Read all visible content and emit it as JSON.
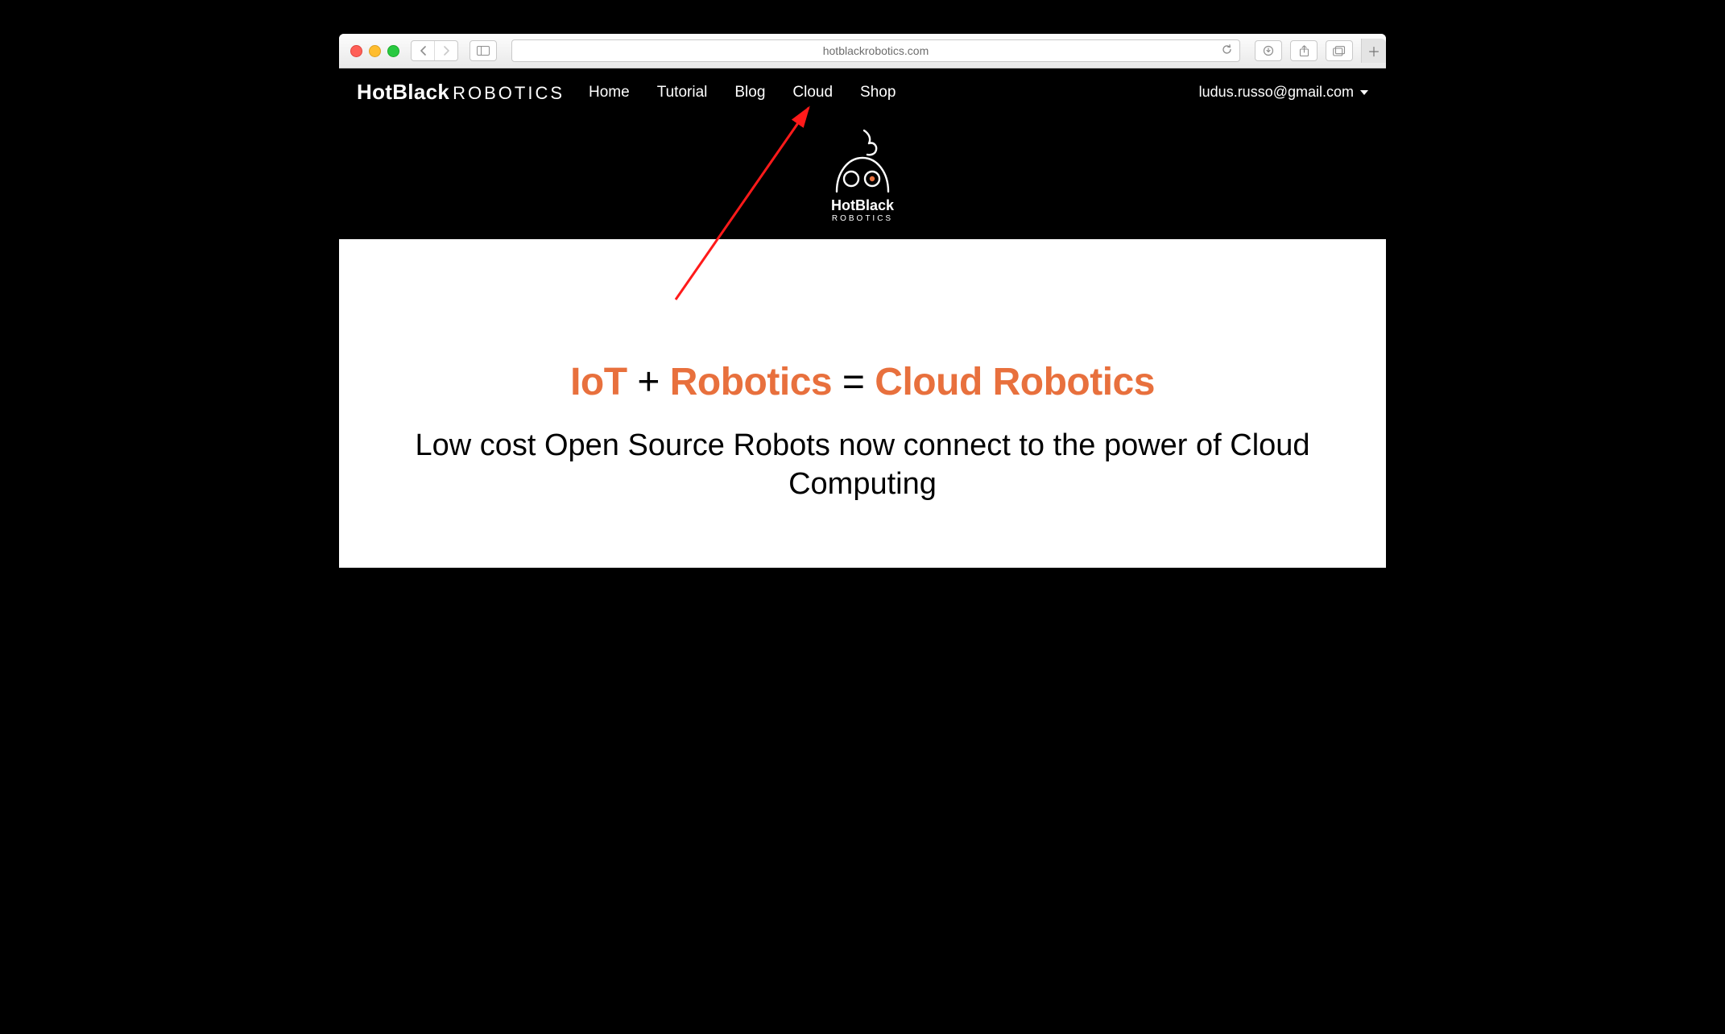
{
  "browser": {
    "url_display": "hotblackrobotics.com"
  },
  "header": {
    "brand_bold": "HotBlack",
    "brand_thin": "ROBOTICS",
    "nav": [
      {
        "label": "Home"
      },
      {
        "label": "Tutorial"
      },
      {
        "label": "Blog"
      },
      {
        "label": "Cloud"
      },
      {
        "label": "Shop"
      }
    ],
    "user_email": "ludus.russo@gmail.com"
  },
  "logo": {
    "line1_bold": "HotBlack",
    "line2": "ROBOTICS"
  },
  "hero": {
    "accent1": "IoT",
    "plain1": " + ",
    "accent2": "Robotics",
    "plain2": " = ",
    "accent3": "Cloud Robotics",
    "subhead": "Low cost Open Source Robots now connect to the power of Cloud Computing"
  },
  "annotation": {
    "points_to_nav_index": 3
  }
}
